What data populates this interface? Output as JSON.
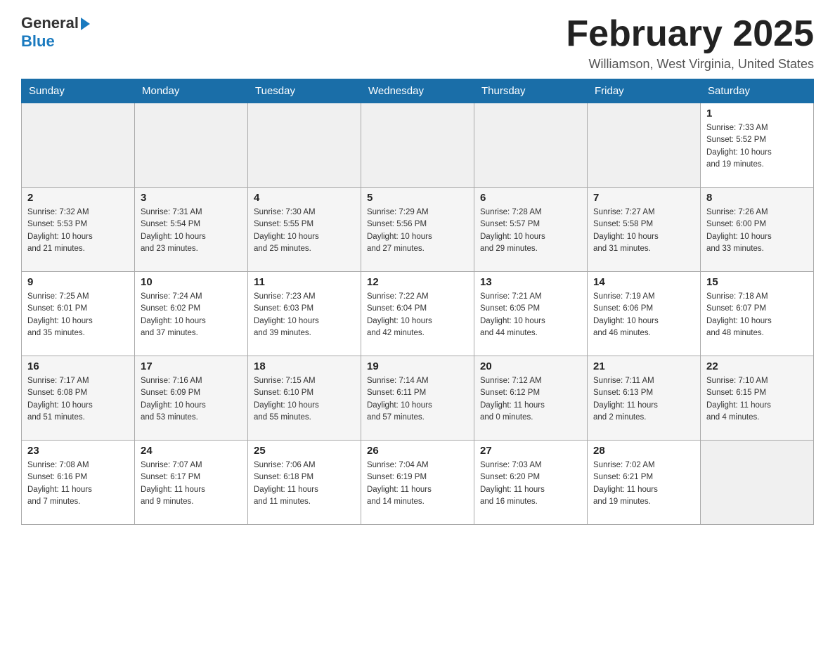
{
  "logo": {
    "text_general": "General",
    "text_blue": "Blue",
    "arrow_char": "▶"
  },
  "title": "February 2025",
  "location": "Williamson, West Virginia, United States",
  "days_of_week": [
    "Sunday",
    "Monday",
    "Tuesday",
    "Wednesday",
    "Thursday",
    "Friday",
    "Saturday"
  ],
  "weeks": [
    {
      "days": [
        {
          "num": "",
          "info": ""
        },
        {
          "num": "",
          "info": ""
        },
        {
          "num": "",
          "info": ""
        },
        {
          "num": "",
          "info": ""
        },
        {
          "num": "",
          "info": ""
        },
        {
          "num": "",
          "info": ""
        },
        {
          "num": "1",
          "info": "Sunrise: 7:33 AM\nSunset: 5:52 PM\nDaylight: 10 hours\nand 19 minutes."
        }
      ]
    },
    {
      "days": [
        {
          "num": "2",
          "info": "Sunrise: 7:32 AM\nSunset: 5:53 PM\nDaylight: 10 hours\nand 21 minutes."
        },
        {
          "num": "3",
          "info": "Sunrise: 7:31 AM\nSunset: 5:54 PM\nDaylight: 10 hours\nand 23 minutes."
        },
        {
          "num": "4",
          "info": "Sunrise: 7:30 AM\nSunset: 5:55 PM\nDaylight: 10 hours\nand 25 minutes."
        },
        {
          "num": "5",
          "info": "Sunrise: 7:29 AM\nSunset: 5:56 PM\nDaylight: 10 hours\nand 27 minutes."
        },
        {
          "num": "6",
          "info": "Sunrise: 7:28 AM\nSunset: 5:57 PM\nDaylight: 10 hours\nand 29 minutes."
        },
        {
          "num": "7",
          "info": "Sunrise: 7:27 AM\nSunset: 5:58 PM\nDaylight: 10 hours\nand 31 minutes."
        },
        {
          "num": "8",
          "info": "Sunrise: 7:26 AM\nSunset: 6:00 PM\nDaylight: 10 hours\nand 33 minutes."
        }
      ]
    },
    {
      "days": [
        {
          "num": "9",
          "info": "Sunrise: 7:25 AM\nSunset: 6:01 PM\nDaylight: 10 hours\nand 35 minutes."
        },
        {
          "num": "10",
          "info": "Sunrise: 7:24 AM\nSunset: 6:02 PM\nDaylight: 10 hours\nand 37 minutes."
        },
        {
          "num": "11",
          "info": "Sunrise: 7:23 AM\nSunset: 6:03 PM\nDaylight: 10 hours\nand 39 minutes."
        },
        {
          "num": "12",
          "info": "Sunrise: 7:22 AM\nSunset: 6:04 PM\nDaylight: 10 hours\nand 42 minutes."
        },
        {
          "num": "13",
          "info": "Sunrise: 7:21 AM\nSunset: 6:05 PM\nDaylight: 10 hours\nand 44 minutes."
        },
        {
          "num": "14",
          "info": "Sunrise: 7:19 AM\nSunset: 6:06 PM\nDaylight: 10 hours\nand 46 minutes."
        },
        {
          "num": "15",
          "info": "Sunrise: 7:18 AM\nSunset: 6:07 PM\nDaylight: 10 hours\nand 48 minutes."
        }
      ]
    },
    {
      "days": [
        {
          "num": "16",
          "info": "Sunrise: 7:17 AM\nSunset: 6:08 PM\nDaylight: 10 hours\nand 51 minutes."
        },
        {
          "num": "17",
          "info": "Sunrise: 7:16 AM\nSunset: 6:09 PM\nDaylight: 10 hours\nand 53 minutes."
        },
        {
          "num": "18",
          "info": "Sunrise: 7:15 AM\nSunset: 6:10 PM\nDaylight: 10 hours\nand 55 minutes."
        },
        {
          "num": "19",
          "info": "Sunrise: 7:14 AM\nSunset: 6:11 PM\nDaylight: 10 hours\nand 57 minutes."
        },
        {
          "num": "20",
          "info": "Sunrise: 7:12 AM\nSunset: 6:12 PM\nDaylight: 11 hours\nand 0 minutes."
        },
        {
          "num": "21",
          "info": "Sunrise: 7:11 AM\nSunset: 6:13 PM\nDaylight: 11 hours\nand 2 minutes."
        },
        {
          "num": "22",
          "info": "Sunrise: 7:10 AM\nSunset: 6:15 PM\nDaylight: 11 hours\nand 4 minutes."
        }
      ]
    },
    {
      "days": [
        {
          "num": "23",
          "info": "Sunrise: 7:08 AM\nSunset: 6:16 PM\nDaylight: 11 hours\nand 7 minutes."
        },
        {
          "num": "24",
          "info": "Sunrise: 7:07 AM\nSunset: 6:17 PM\nDaylight: 11 hours\nand 9 minutes."
        },
        {
          "num": "25",
          "info": "Sunrise: 7:06 AM\nSunset: 6:18 PM\nDaylight: 11 hours\nand 11 minutes."
        },
        {
          "num": "26",
          "info": "Sunrise: 7:04 AM\nSunset: 6:19 PM\nDaylight: 11 hours\nand 14 minutes."
        },
        {
          "num": "27",
          "info": "Sunrise: 7:03 AM\nSunset: 6:20 PM\nDaylight: 11 hours\nand 16 minutes."
        },
        {
          "num": "28",
          "info": "Sunrise: 7:02 AM\nSunset: 6:21 PM\nDaylight: 11 hours\nand 19 minutes."
        },
        {
          "num": "",
          "info": ""
        }
      ]
    }
  ]
}
